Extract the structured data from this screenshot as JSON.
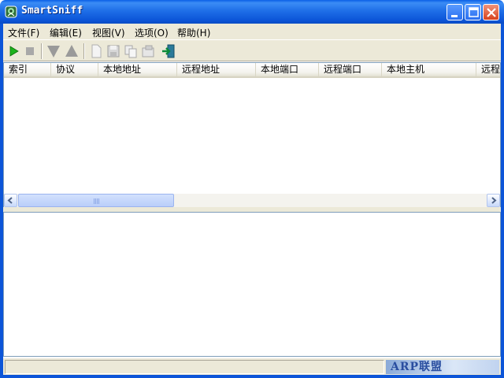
{
  "window": {
    "title": "SmartSniff"
  },
  "menu": [
    {
      "label": "文件(F)"
    },
    {
      "label": "编辑(E)"
    },
    {
      "label": "视图(V)"
    },
    {
      "label": "选项(O)"
    },
    {
      "label": "帮助(H)"
    }
  ],
  "toolbar": {
    "icons": [
      "start-capture-icon",
      "stop-capture-icon",
      "next-icon",
      "previous-icon",
      "new-icon",
      "save-icon",
      "copy-icon",
      "properties-icon",
      "exit-icon"
    ]
  },
  "list": {
    "columns": [
      "索引",
      "协议",
      "本地地址",
      "远程地址",
      "本地端口",
      "远程端口",
      "本地主机",
      "远程主机"
    ]
  },
  "status": {
    "watermark": "ARP联盟"
  },
  "colors": {
    "titlebar": "#0c55d8",
    "chrome": "#ece9d8",
    "close_button": "#d8431e"
  }
}
